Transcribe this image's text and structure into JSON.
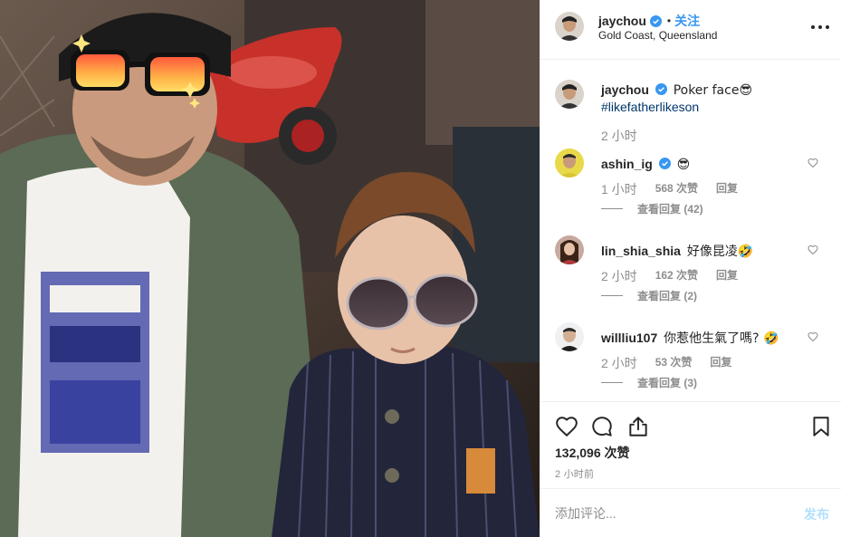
{
  "post": {
    "author": "jaychou",
    "follow_label": "关注",
    "dot": "•",
    "location": "Gold Coast, Queensland",
    "caption": {
      "username": "jaychou",
      "text": "Poker face😎",
      "hashtag": "#likefatherlikeson",
      "time": "2 小时"
    }
  },
  "comments": [
    {
      "username": "ashin_ig",
      "text": "😎",
      "time": "1 小时",
      "likes": "568 次赞",
      "reply_label": "回复",
      "view_replies": "查看回复 (42)",
      "verified": true
    },
    {
      "username": "lin_shia_shia",
      "text": "好像昆凌🤣",
      "time": "2 小时",
      "likes": "162 次赞",
      "reply_label": "回复",
      "view_replies": "查看回复 (2)",
      "verified": false
    },
    {
      "username": "willliu107",
      "text": "你惹他生氣了嗎? 🤣",
      "time": "2 小时",
      "likes": "53 次赞",
      "reply_label": "回复",
      "view_replies": "查看回复 (3)",
      "verified": false
    }
  ],
  "actions": {
    "likes_count": "132,096 次赞",
    "post_time": "2 小时前"
  },
  "composer": {
    "placeholder": "添加评论...",
    "post_label": "发布"
  },
  "colors": {
    "link_blue": "#3897f0",
    "hashtag": "#003569",
    "secondary_text": "#8e8e8e",
    "post_disabled": "#b2dffc"
  }
}
